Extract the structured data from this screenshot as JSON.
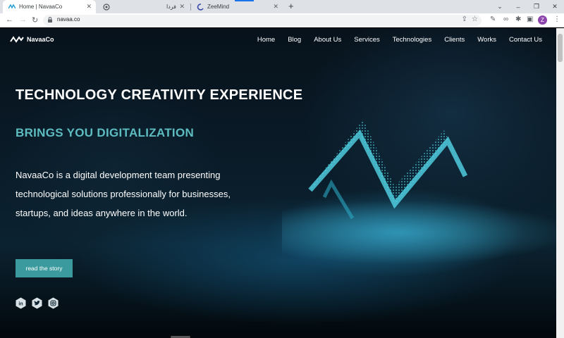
{
  "browser": {
    "tabs": [
      {
        "title": "Home | NavaaCo",
        "active": true
      },
      {
        "title": "فردا",
        "active": false
      },
      {
        "title": "ZeeMind",
        "active": false
      }
    ],
    "address": "navaa.co",
    "profile_initial": "Z",
    "icons": [
      "back-icon",
      "forward-icon",
      "reload-icon",
      "lock-icon",
      "share-icon",
      "star-icon",
      "extension-icon",
      "puzzle-icon",
      "sidebar-icon",
      "menu-icon"
    ]
  },
  "site": {
    "brand": "NavaaCo",
    "nav": [
      "Home",
      "Blog",
      "About Us",
      "Services",
      "Technologies",
      "Clients",
      "Works",
      "Contact Us"
    ],
    "headline": "TECHNOLOGY CREATIVITY EXPERIENCE",
    "subheadline": "BRINGS YOU DIGITALIZATION",
    "description": "NavaaCo is a digital development team presenting technological solutions professionally for businesses, startups, and ideas anywhere in the world.",
    "cta": "read the story",
    "socials": [
      "linkedin-icon",
      "twitter-icon",
      "instagram-icon"
    ]
  },
  "colors": {
    "accent": "#5dbcc0",
    "button": "#3a9a9d",
    "hero_glow": "#2fd0e0"
  }
}
